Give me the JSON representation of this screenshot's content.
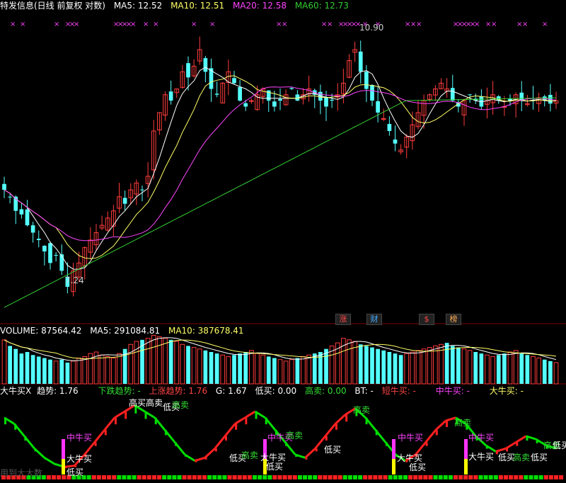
{
  "price_header": {
    "title": "特发信息(日线 前复权 对数)",
    "ma5": "MA5: 12.52",
    "ma10": "MA10: 12.51",
    "ma20": "MA20: 12.58",
    "ma60": "MA60: 12.73"
  },
  "volume_header": {
    "volume": "VOLUME: 87564.42",
    "ma5": "MA5: 291084.81",
    "ma10": "MA10: 387678.41"
  },
  "indicator_header": {
    "name": "大牛买X",
    "trend": "趋势: 1.76",
    "down_trend": "下跌趋势: -",
    "up_trend": "上涨趋势: 1.76",
    "g": "G: 1.67",
    "low_buy": "低买: 0.00",
    "high_sell": "高卖: 0.00",
    "bt": "BT: -",
    "short_bull": "短牛买: -",
    "mid_bull": "中牛买: -",
    "big_bull": "大牛买: -"
  },
  "colors": {
    "up": "#ff3c3c",
    "down": "#54ffff",
    "ma5": "#ffffff",
    "ma10": "#ffff66",
    "ma20": "#ff44ff",
    "ma60": "#33cc33",
    "signal_red": "#ff2020",
    "signal_green": "#00dd00",
    "magenta": "#ff33ff",
    "yellow": "#ffff00"
  },
  "price_labels": {
    "high": "10.90",
    "low": "7.24"
  },
  "event_tags": [
    {
      "label": "涨",
      "color": "#ff4444"
    },
    {
      "label": "财",
      "color": "#44aaff"
    },
    {
      "label": "$",
      "color": "#ff4444"
    },
    {
      "label": "榜",
      "color": "#ffaa55"
    }
  ],
  "signals": {
    "high_sell": "高卖",
    "low_buy": "低买",
    "mid_bull": "中牛买",
    "big_bull": "大牛买",
    "high_buy": "高买",
    "bottom_partial": "用到大大数"
  },
  "chart_data": [
    {
      "type": "candlestick",
      "title": "特发信息(日线 前复权 对数)",
      "scale": "log",
      "ylim": [
        7.0,
        11.3
      ],
      "annotations": [
        {
          "text": "10.90",
          "type": "high"
        },
        {
          "text": "7.24",
          "type": "low"
        }
      ],
      "close": [
        8.6,
        8.5,
        8.3,
        8.25,
        8.1,
        8.0,
        7.9,
        7.75,
        7.6,
        7.7,
        7.5,
        7.3,
        7.5,
        7.6,
        7.8,
        7.9,
        8.0,
        8.1,
        8.2,
        8.3,
        8.5,
        8.4,
        8.6,
        8.7,
        8.6,
        8.8,
        9.5,
        9.8,
        10.1,
        10.0,
        10.2,
        10.5,
        10.4,
        10.6,
        10.9,
        10.5,
        10.2,
        10.1,
        10.3,
        10.5,
        10.3,
        10.0,
        9.9,
        10.0,
        10.1,
        10.2,
        10.0,
        9.9,
        10.0,
        10.1,
        10.2,
        10.0,
        10.1,
        10.2,
        10.1,
        10.0,
        9.9,
        10.0,
        10.1,
        10.3,
        10.7,
        10.9,
        10.5,
        10.2,
        10.0,
        9.8,
        9.7,
        9.5,
        9.3,
        9.2,
        9.4,
        9.6,
        9.8,
        10.0,
        10.1,
        10.2,
        10.3,
        10.2,
        10.0,
        9.9,
        10.0,
        10.1,
        10.0,
        9.9,
        10.0,
        10.1,
        10.0,
        9.9,
        10.0,
        10.1,
        10.0,
        9.95,
        10.0,
        10.05,
        10.0,
        9.95,
        10.0
      ],
      "series_names": [
        "MA5",
        "MA10",
        "MA20",
        "MA60"
      ]
    },
    {
      "type": "bar",
      "title": "VOLUME",
      "values": [
        290,
        250,
        230,
        200,
        210,
        190,
        180,
        170,
        160,
        150,
        160,
        140,
        150,
        170,
        180,
        200,
        210,
        190,
        180,
        170,
        200,
        230,
        260,
        280,
        290,
        300,
        320,
        310,
        300,
        290,
        280,
        260,
        250,
        240,
        230,
        220,
        210,
        200,
        190,
        180,
        190,
        200,
        210,
        220,
        200,
        190,
        180,
        170,
        160,
        150,
        160,
        170,
        180,
        190,
        200,
        210,
        230,
        250,
        270,
        300,
        290,
        280,
        260,
        250,
        240,
        230,
        220,
        210,
        200,
        190,
        200,
        210,
        220,
        230,
        240,
        250,
        260,
        270,
        250,
        240,
        230,
        220,
        210,
        200,
        190,
        180,
        190,
        200,
        210,
        220,
        200,
        190,
        180,
        170,
        160,
        150,
        140
      ],
      "series_names": [
        "MA5",
        "MA10"
      ]
    },
    {
      "type": "line",
      "title": "大牛买X",
      "series": [
        {
          "name": "趋势",
          "values": [
            0.9,
            0.8,
            0.6,
            0.4,
            0.25,
            0.15,
            0.1,
            0.12,
            0.3,
            0.5,
            0.7,
            0.9,
            1.0,
            1.1,
            1.0,
            0.9,
            0.7,
            0.5,
            0.3,
            0.2,
            0.25,
            0.4,
            0.6,
            0.8,
            0.9,
            1.0,
            0.9,
            0.7,
            0.5,
            0.3,
            0.25,
            0.4,
            0.6,
            0.8,
            0.95,
            1.05,
            0.9,
            0.7,
            0.5,
            0.3,
            0.2,
            0.3,
            0.5,
            0.7,
            0.85,
            0.9,
            0.8,
            0.6,
            0.45,
            0.35,
            0.4,
            0.5,
            0.6,
            0.55,
            0.45,
            0.4
          ]
        }
      ]
    }
  ]
}
